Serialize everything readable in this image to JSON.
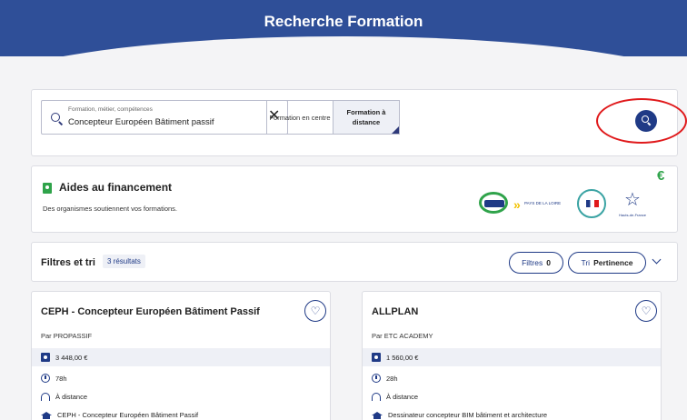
{
  "header": {
    "title": "Recherche Formation"
  },
  "search": {
    "field_label": "Formation, métier, compétences",
    "value": "Concepteur Européen Bâtiment passif",
    "clear_icon": "✕",
    "modes": [
      "Formation en centre",
      "Formation à distance"
    ],
    "active_mode": "Formation à distance"
  },
  "aids": {
    "title": "Aides au financement",
    "subtitle": "Des organismes soutiennent vos formations.",
    "euro_symbol": "€",
    "logos": [
      {
        "icon": "region-formation-logo"
      },
      {
        "icon": "pays-de-la-loire-logo",
        "text": "PAYS DE LA LOIRE"
      },
      {
        "icon": "france-travail-logo"
      },
      {
        "icon": "hauts-de-france-logo",
        "text": "Hauts-de-France"
      }
    ]
  },
  "filters": {
    "title": "Filtres et tri",
    "result_count": "3 résultats",
    "filters_label": "Filtres",
    "filters_count": "0",
    "sort_label": "Tri",
    "sort_value": "Pertinence"
  },
  "results": [
    {
      "title": "CEPH - Concepteur Européen Bâtiment Passif",
      "provider": "Par PROPASSIF",
      "price": "3 448,00 €",
      "duration": "78h",
      "mode": "À distance",
      "certification": "CEPH - Concepteur Européen Bâtiment Passif"
    },
    {
      "title": "ALLPLAN",
      "provider": "Par ETC ACADEMY",
      "price": "1 560,00 €",
      "duration": "28h",
      "mode": "À distance",
      "certification": "Dessinateur concepteur BIM bâtiment et architecture"
    }
  ],
  "colors": {
    "primary": "#1f3a86",
    "header": "#2f4f98",
    "accent_green": "#2fa34a",
    "annotation": "#e0191b"
  }
}
